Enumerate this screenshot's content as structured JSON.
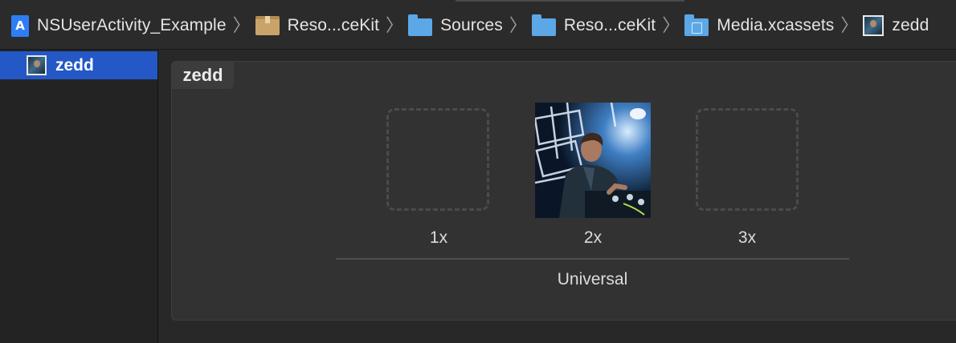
{
  "breadcrumb": [
    {
      "label": "NSUserActivity_Example",
      "icon": "xcode-project-icon"
    },
    {
      "label": "Reso...ceKit",
      "icon": "package-icon"
    },
    {
      "label": "Sources",
      "icon": "folder-icon"
    },
    {
      "label": "Reso...ceKit",
      "icon": "folder-icon"
    },
    {
      "label": "Media.xcassets",
      "icon": "asset-catalog-icon"
    },
    {
      "label": "zedd",
      "icon": "image-thumbnail-icon"
    }
  ],
  "sidebar": {
    "items": [
      {
        "label": "zedd",
        "selected": true,
        "icon": "image-thumbnail-icon"
      }
    ],
    "selection_color": "#2358c6"
  },
  "image_set": {
    "name": "zedd",
    "slots": [
      {
        "scale": "1x",
        "filled": false
      },
      {
        "scale": "2x",
        "filled": true
      },
      {
        "scale": "3x",
        "filled": false
      }
    ],
    "idiom": "Universal"
  },
  "colors": {
    "accent": "#2358c6",
    "background": "#282828",
    "panel": "#323232"
  }
}
